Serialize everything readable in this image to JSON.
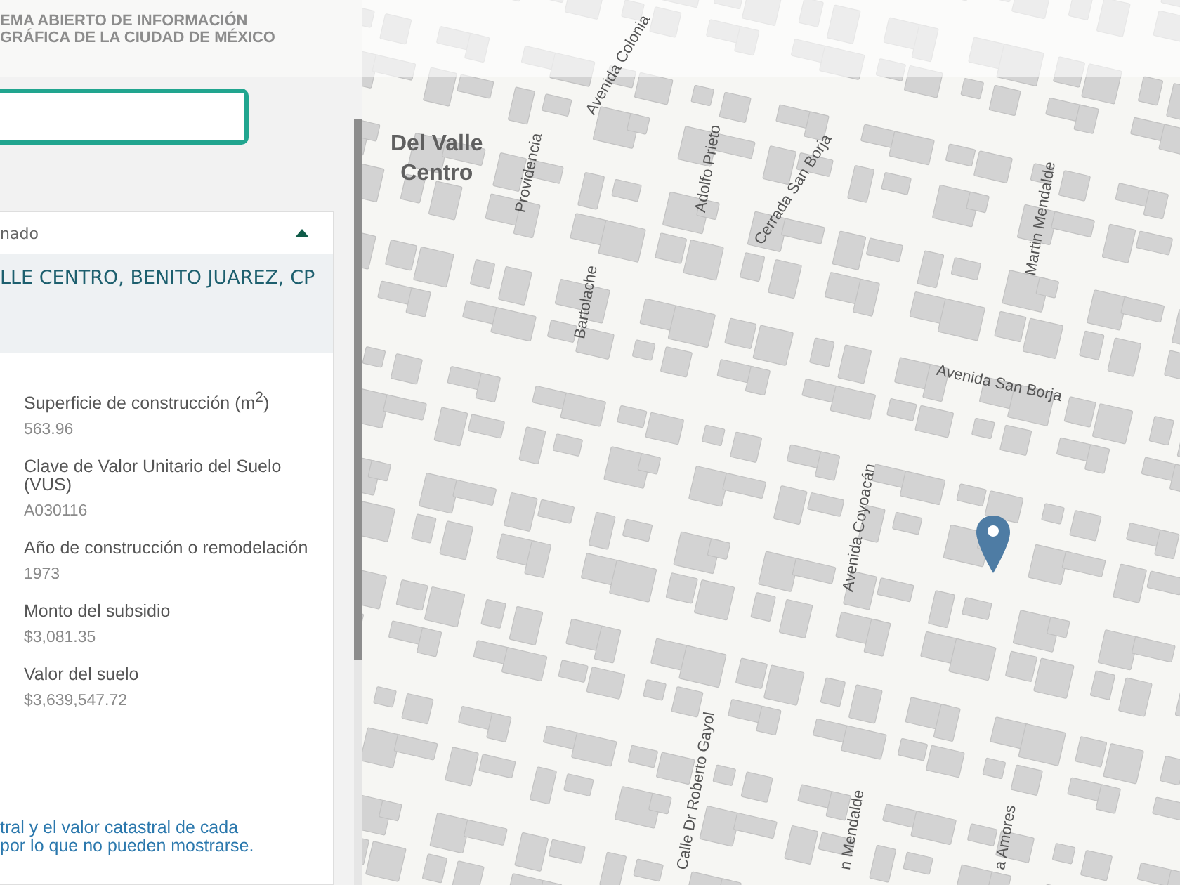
{
  "header": {
    "title_lines": [
      "EMA ABIERTO DE INFORMACIÓN",
      "GRÁFICA DE LA CIUDAD DE MÉXICO"
    ]
  },
  "panel": {
    "heading": "nado",
    "expanded": true,
    "address": "LLE CENTRO, BENITO JUAREZ, CP",
    "fields": [
      {
        "label": "Superficie de construcción (m$^{2}$)",
        "value": "563.96"
      },
      {
        "label": "Clave de Valor Unitario del Suelo (VUS)",
        "value": "A030116"
      },
      {
        "label": "Año de construcción o remodelación",
        "value": "1973"
      },
      {
        "label": "Monto del subsidio",
        "value": "$3,081.35"
      },
      {
        "label": "Valor del suelo",
        "value": "$3,639,547.72"
      }
    ],
    "note_lines": [
      "tral y el valor catastral de cada",
      "por lo que no pueden mostrarse."
    ]
  },
  "map": {
    "area_label_lines": [
      "Del Valle",
      "Centro"
    ],
    "street_labels": [
      "Avenida Colonia",
      "Providencia",
      "Adolfo Prieto",
      "Cerrada San Borja",
      "Martin Mendalde",
      "Bartolache",
      "Avenida San Borja",
      "Avenida Coyoacán",
      "Calle Dr Roberto Gayol",
      "n Mendalde",
      "a Amores"
    ]
  }
}
